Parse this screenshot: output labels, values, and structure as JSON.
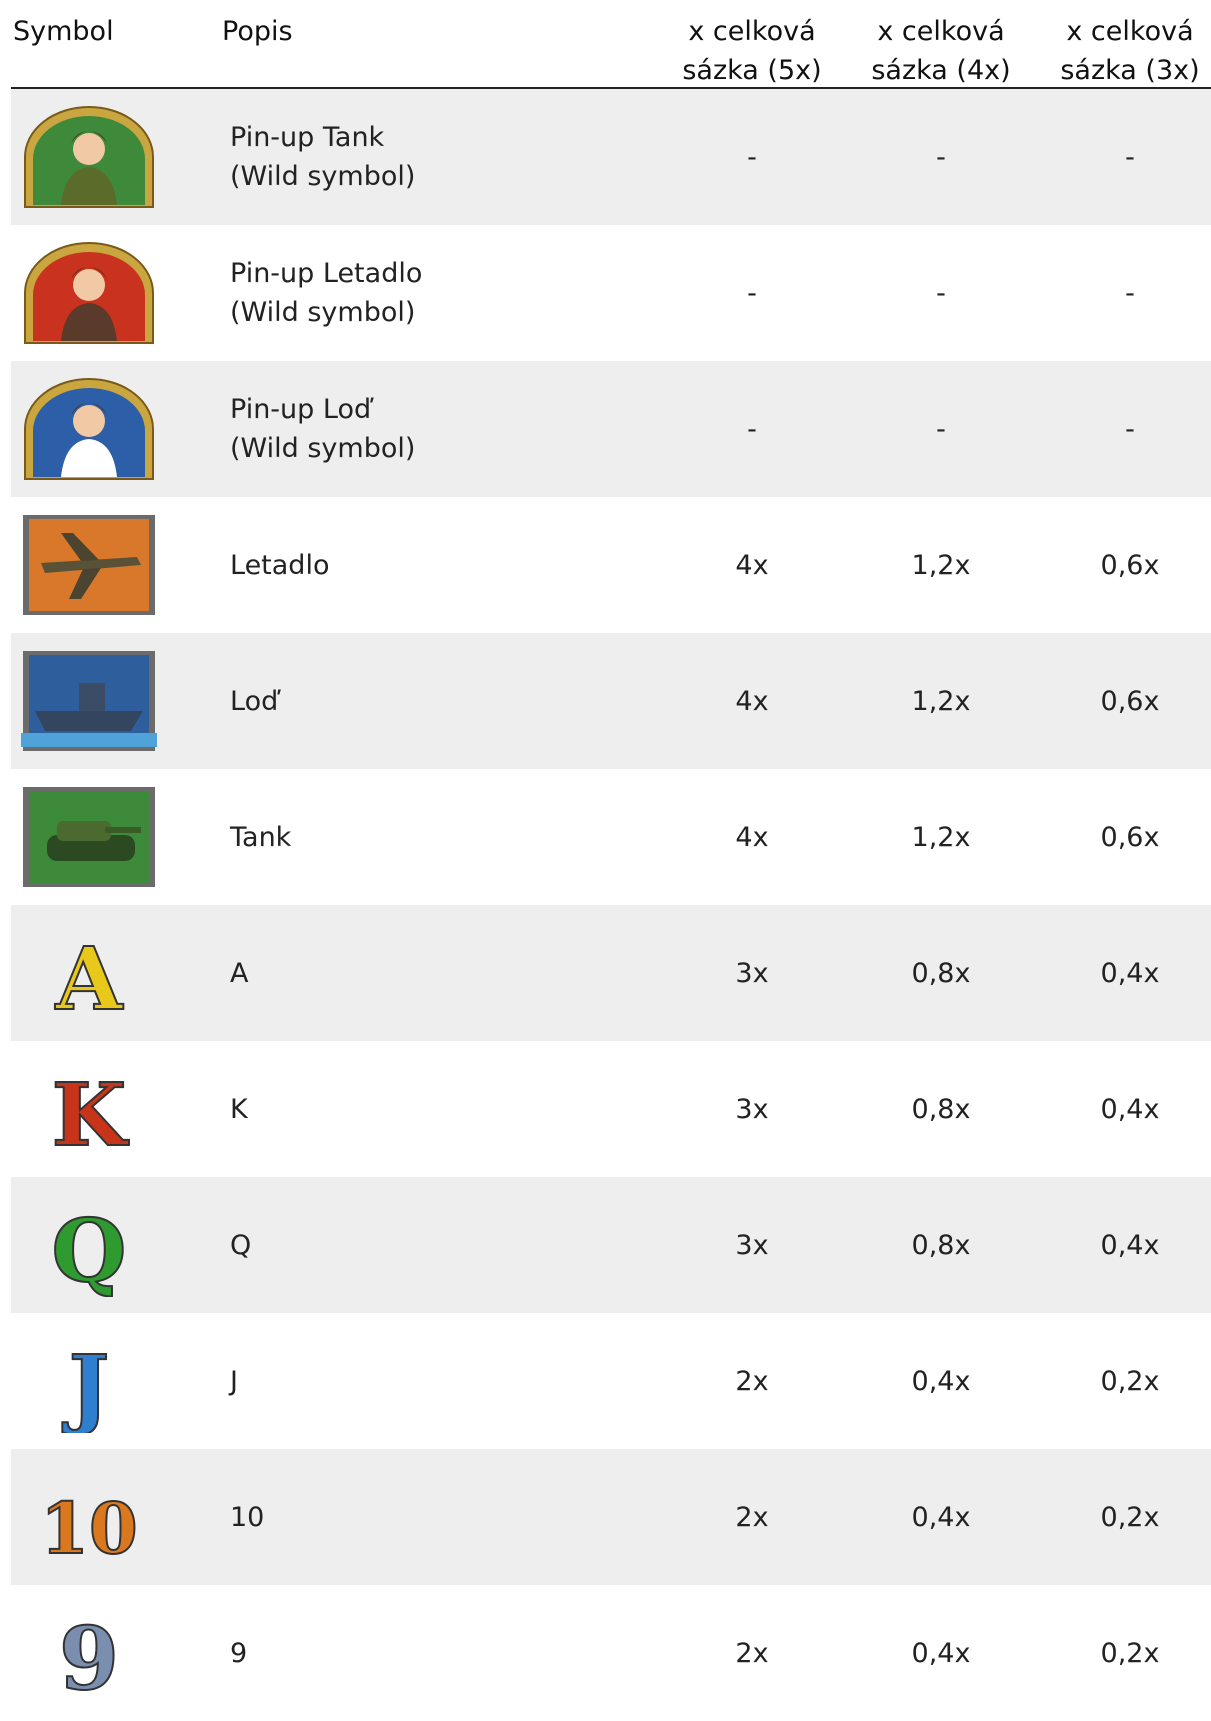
{
  "headers": {
    "symbol": "Symbol",
    "description": "Popis",
    "col5": [
      "x celková",
      "sázka (5x)"
    ],
    "col4": [
      "x celková",
      "sázka (4x)"
    ],
    "col3": [
      "x celková",
      "sázka (3x)"
    ]
  },
  "rows": [
    {
      "icon": "pinup-tank-icon",
      "name": "Pin-up Tank",
      "note": "(Wild symbol)",
      "x5": "-",
      "x4": "-",
      "x3": "-"
    },
    {
      "icon": "pinup-plane-icon",
      "name": "Pin-up Letadlo",
      "note": "(Wild symbol)",
      "x5": "-",
      "x4": "-",
      "x3": "-"
    },
    {
      "icon": "pinup-ship-icon",
      "name": "Pin-up Loď",
      "note": "(Wild symbol)",
      "x5": "-",
      "x4": "-",
      "x3": "-"
    },
    {
      "icon": "plane-icon",
      "name": "Letadlo",
      "note": "",
      "x5": "4x",
      "x4": "1,2x",
      "x3": "0,6x"
    },
    {
      "icon": "ship-icon",
      "name": "Loď",
      "note": "",
      "x5": "4x",
      "x4": "1,2x",
      "x3": "0,6x"
    },
    {
      "icon": "tank-icon",
      "name": "Tank",
      "note": "",
      "x5": "4x",
      "x4": "1,2x",
      "x3": "0,6x"
    },
    {
      "icon": "letter-a-icon",
      "glyph": "A",
      "name": "A",
      "note": "",
      "x5": "3x",
      "x4": "0,8x",
      "x3": "0,4x"
    },
    {
      "icon": "letter-k-icon",
      "glyph": "K",
      "name": "K",
      "note": "",
      "x5": "3x",
      "x4": "0,8x",
      "x3": "0,4x"
    },
    {
      "icon": "letter-q-icon",
      "glyph": "Q",
      "name": "Q",
      "note": "",
      "x5": "3x",
      "x4": "0,8x",
      "x3": "0,4x"
    },
    {
      "icon": "letter-j-icon",
      "glyph": "J",
      "name": "J",
      "note": "",
      "x5": "2x",
      "x4": "0,4x",
      "x3": "0,2x"
    },
    {
      "icon": "number-10-icon",
      "glyph": "10",
      "name": "10",
      "note": "",
      "x5": "2x",
      "x4": "0,4x",
      "x3": "0,2x"
    },
    {
      "icon": "number-9-icon",
      "glyph": "9",
      "name": "9",
      "note": "",
      "x5": "2x",
      "x4": "0,4x",
      "x3": "0,2x"
    }
  ],
  "colors": {
    "row_alt": "#eeeeee",
    "letter_a": "#e8c81a",
    "letter_k": "#c8341a",
    "letter_q": "#2f9a2f",
    "letter_j": "#2f7fd0",
    "number_10": "#d9781f",
    "number_9": "#7a8fb0"
  }
}
